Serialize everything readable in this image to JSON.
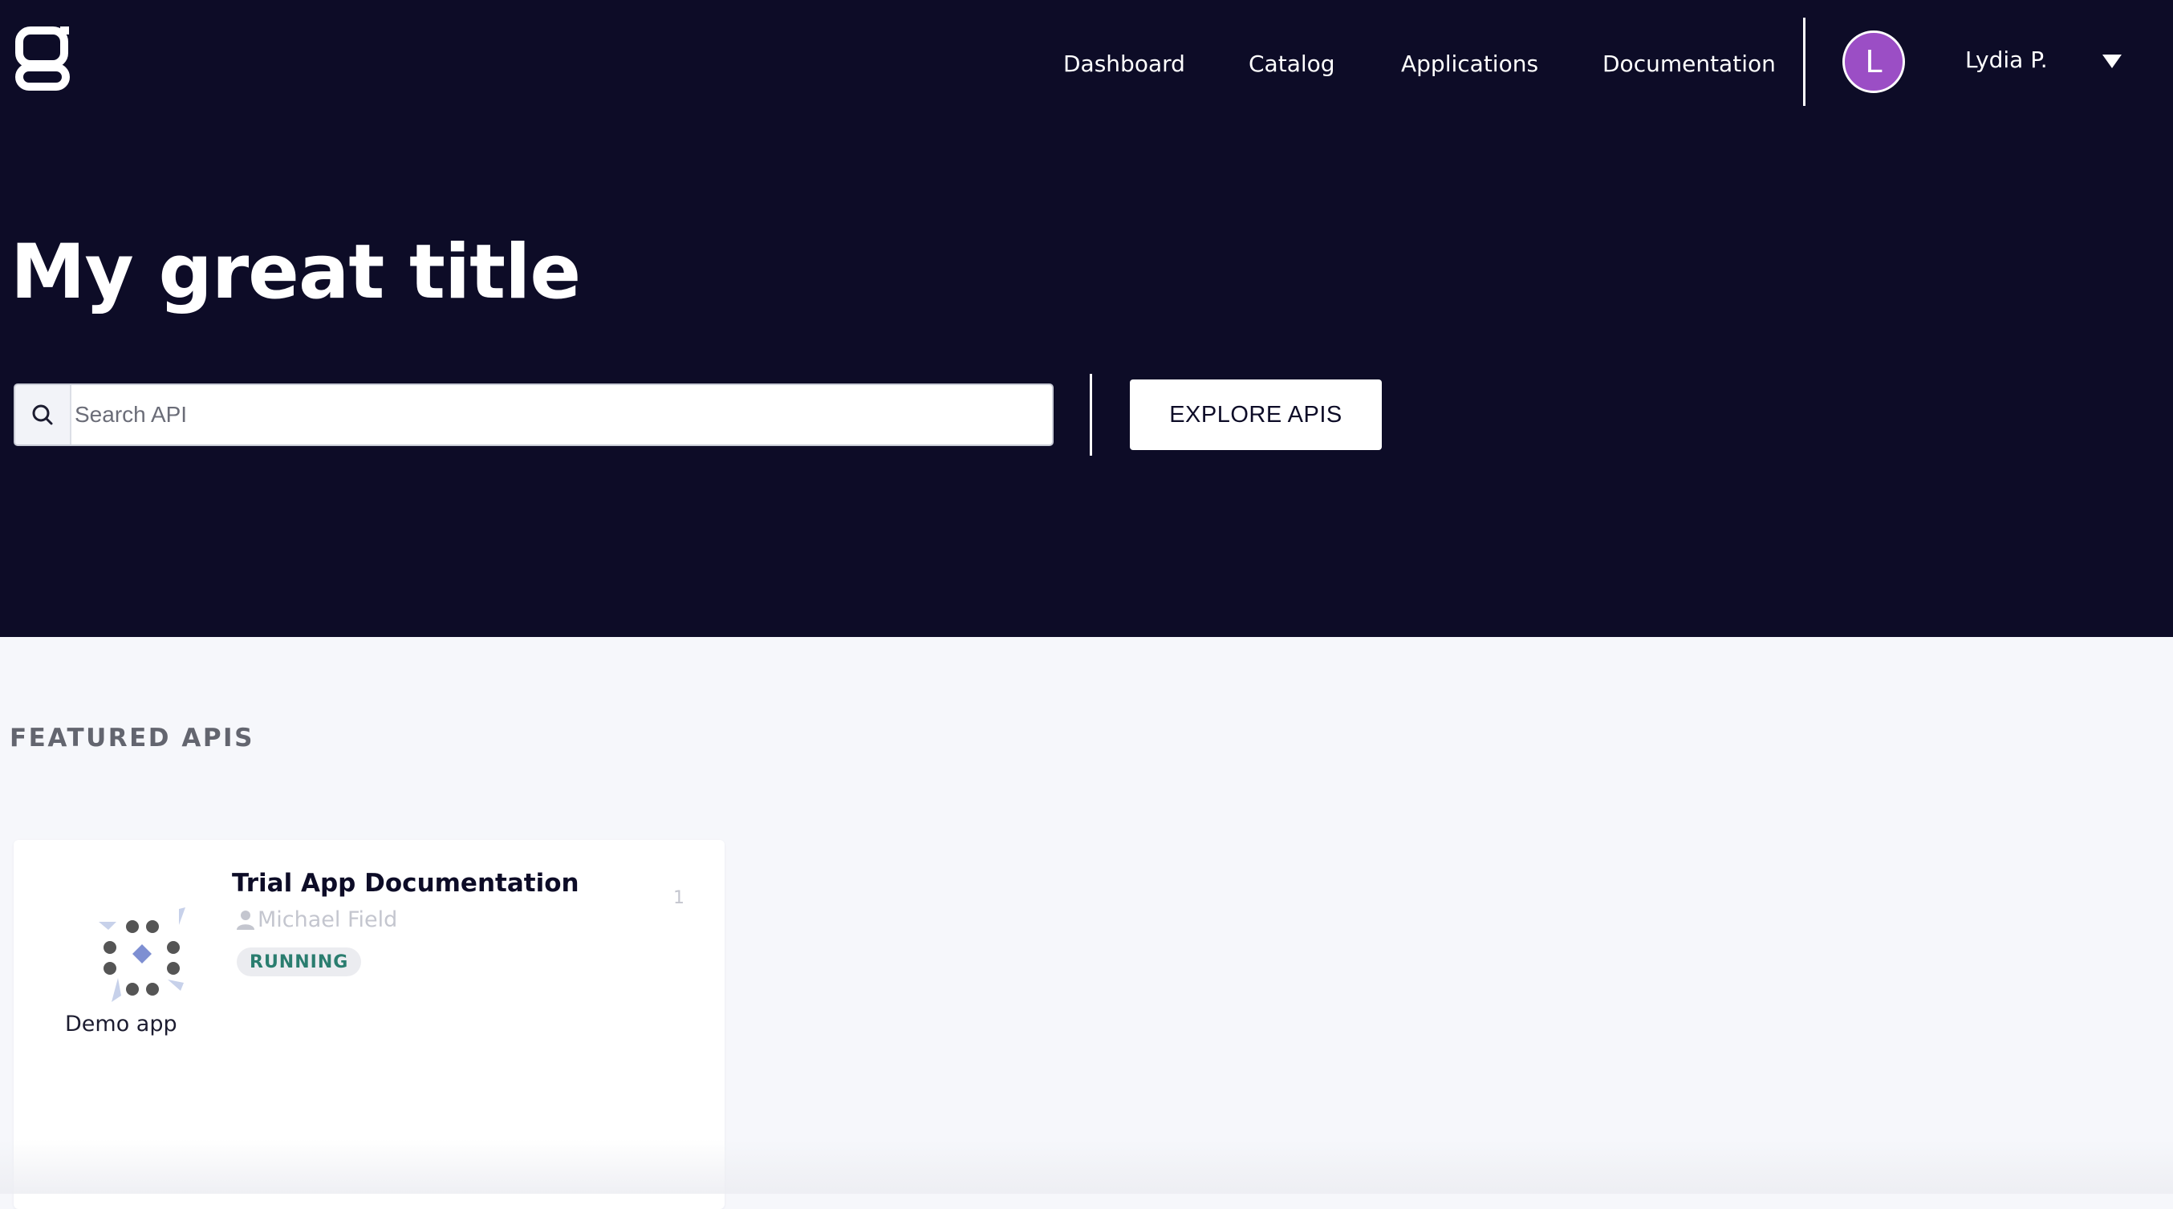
{
  "header": {
    "logo_icon": "brand-g-logo-icon",
    "nav": [
      {
        "label": "Dashboard"
      },
      {
        "label": "Catalog"
      },
      {
        "label": "Applications"
      },
      {
        "label": "Documentation"
      }
    ],
    "user": {
      "initial": "L",
      "name": "Lydia P.",
      "avatar_color": "#9b4ec5",
      "menu_icon": "caret-down-icon"
    }
  },
  "hero": {
    "title": "My great title",
    "search": {
      "placeholder": "Search API",
      "value": "",
      "icon": "search-icon"
    },
    "explore_button": "EXPLORE APIS",
    "background_color": "#0d0c27"
  },
  "featured": {
    "title": "FEATURED APIS",
    "cards": [
      {
        "title": "Trial App Documentation",
        "owner": "Michael Field",
        "owner_icon": "user-icon",
        "status": "RUNNING",
        "status_color": "#2a7d6f",
        "count": "1",
        "app_name": "Demo app",
        "logo_icon": "app-dots-logo-icon"
      }
    ]
  }
}
